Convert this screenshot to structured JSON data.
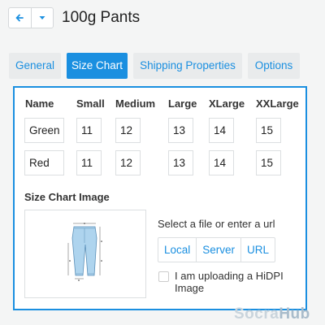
{
  "header": {
    "title": "100g Pants",
    "back_icon": "arrow-left-icon",
    "menu_icon": "caret-down-icon"
  },
  "tabs": [
    {
      "label": "General",
      "active": false
    },
    {
      "label": "Size Chart",
      "active": true
    },
    {
      "label": "Shipping Properties",
      "active": false
    },
    {
      "label": "Options",
      "active": false
    }
  ],
  "size_chart": {
    "columns": [
      "Name",
      "Small",
      "Medium",
      "Large",
      "XLarge",
      "XXLarge"
    ],
    "rows": [
      [
        "Green",
        "11",
        "12",
        "13",
        "14",
        "15"
      ],
      [
        "Red",
        "11",
        "12",
        "13",
        "14",
        "15"
      ]
    ]
  },
  "image_section": {
    "title": "Size Chart Image",
    "prompt": "Select a file or enter a url",
    "sources": [
      "Local",
      "Server",
      "URL"
    ],
    "hidpi_label": "I am uploading a HiDPI Image",
    "hidpi_checked": false
  },
  "watermark": {
    "part1": "Socra",
    "part2": "Hub"
  },
  "colors": {
    "accent": "#1a8fe0",
    "tab_bg": "#e9ebec",
    "border": "#dcdfe1"
  }
}
